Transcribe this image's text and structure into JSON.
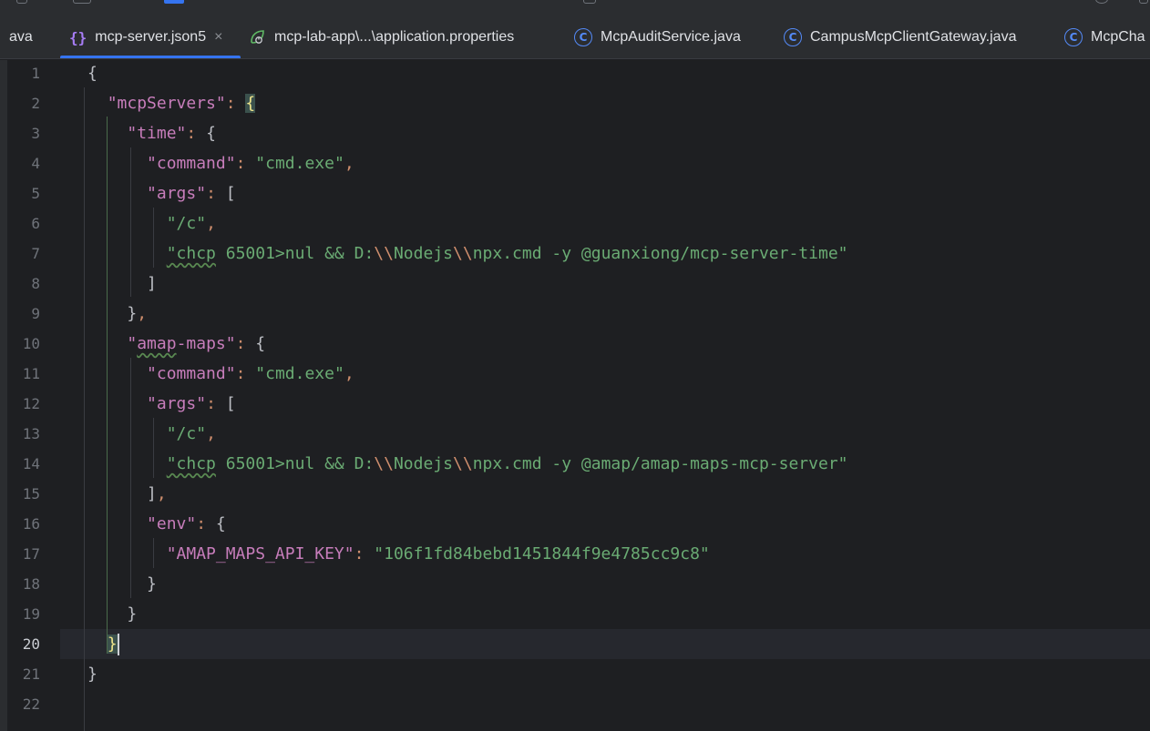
{
  "tabs": [
    {
      "label": "ava",
      "icon": "none",
      "active": false
    },
    {
      "label": "mcp-server.json5",
      "icon": "json-braces-icon",
      "active": true,
      "closable": true
    },
    {
      "label": "mcp-lab-app\\...\\application.properties",
      "icon": "spring-leaf-icon",
      "active": false
    },
    {
      "label": "McpAuditService.java",
      "icon": "java-class-icon",
      "active": false
    },
    {
      "label": "CampusMcpClientGateway.java",
      "icon": "java-class-icon",
      "active": false
    },
    {
      "label": "McpCha",
      "icon": "java-class-icon",
      "active": false
    }
  ],
  "close_glyph": "×",
  "class_glyph": "C",
  "editor": {
    "current_line": 20,
    "line_numbers": [
      "1",
      "2",
      "3",
      "4",
      "5",
      "6",
      "7",
      "8",
      "9",
      "10",
      "11",
      "12",
      "13",
      "14",
      "15",
      "16",
      "17",
      "18",
      "19",
      "20",
      "21",
      "22"
    ],
    "lines": {
      "l1": "{",
      "l2_key": "\"mcpServers\"",
      "l3_key": "\"time\"",
      "l4_key": "\"command\"",
      "l4_val": "\"cmd.exe\"",
      "l5_key": "\"args\"",
      "l6_val": "\"/c\"",
      "l7_a": "\"chcp",
      "l7_b": " 65001>nul && D:",
      "l7_c": "Nodejs",
      "l7_d": "npx.cmd -y @guanxiong/mcp-server-time\"",
      "l10_key_a": "\"",
      "l10_key_b": "amap",
      "l10_key_c": "-maps\"",
      "l11_key": "\"command\"",
      "l11_val": "\"cmd.exe\"",
      "l12_key": "\"args\"",
      "l13_val": "\"/c\"",
      "l14_a": "\"chcp",
      "l14_b": " 65001>nul && D:",
      "l14_c": "Nodejs",
      "l14_d": "npx.cmd -y @amap/amap-maps-mcp-server\"",
      "l16_key": "\"env\"",
      "l17_key": "\"AMAP_MAPS_API_KEY\"",
      "l17_val": "\"106f1fd84bebd1451844f9e4785cc9c8\"",
      "backslashes": "\\\\"
    }
  },
  "colors": {
    "background": "#1e1f22",
    "key": "#c77dbb",
    "string": "#6aab73",
    "accent": "#3574f0"
  }
}
